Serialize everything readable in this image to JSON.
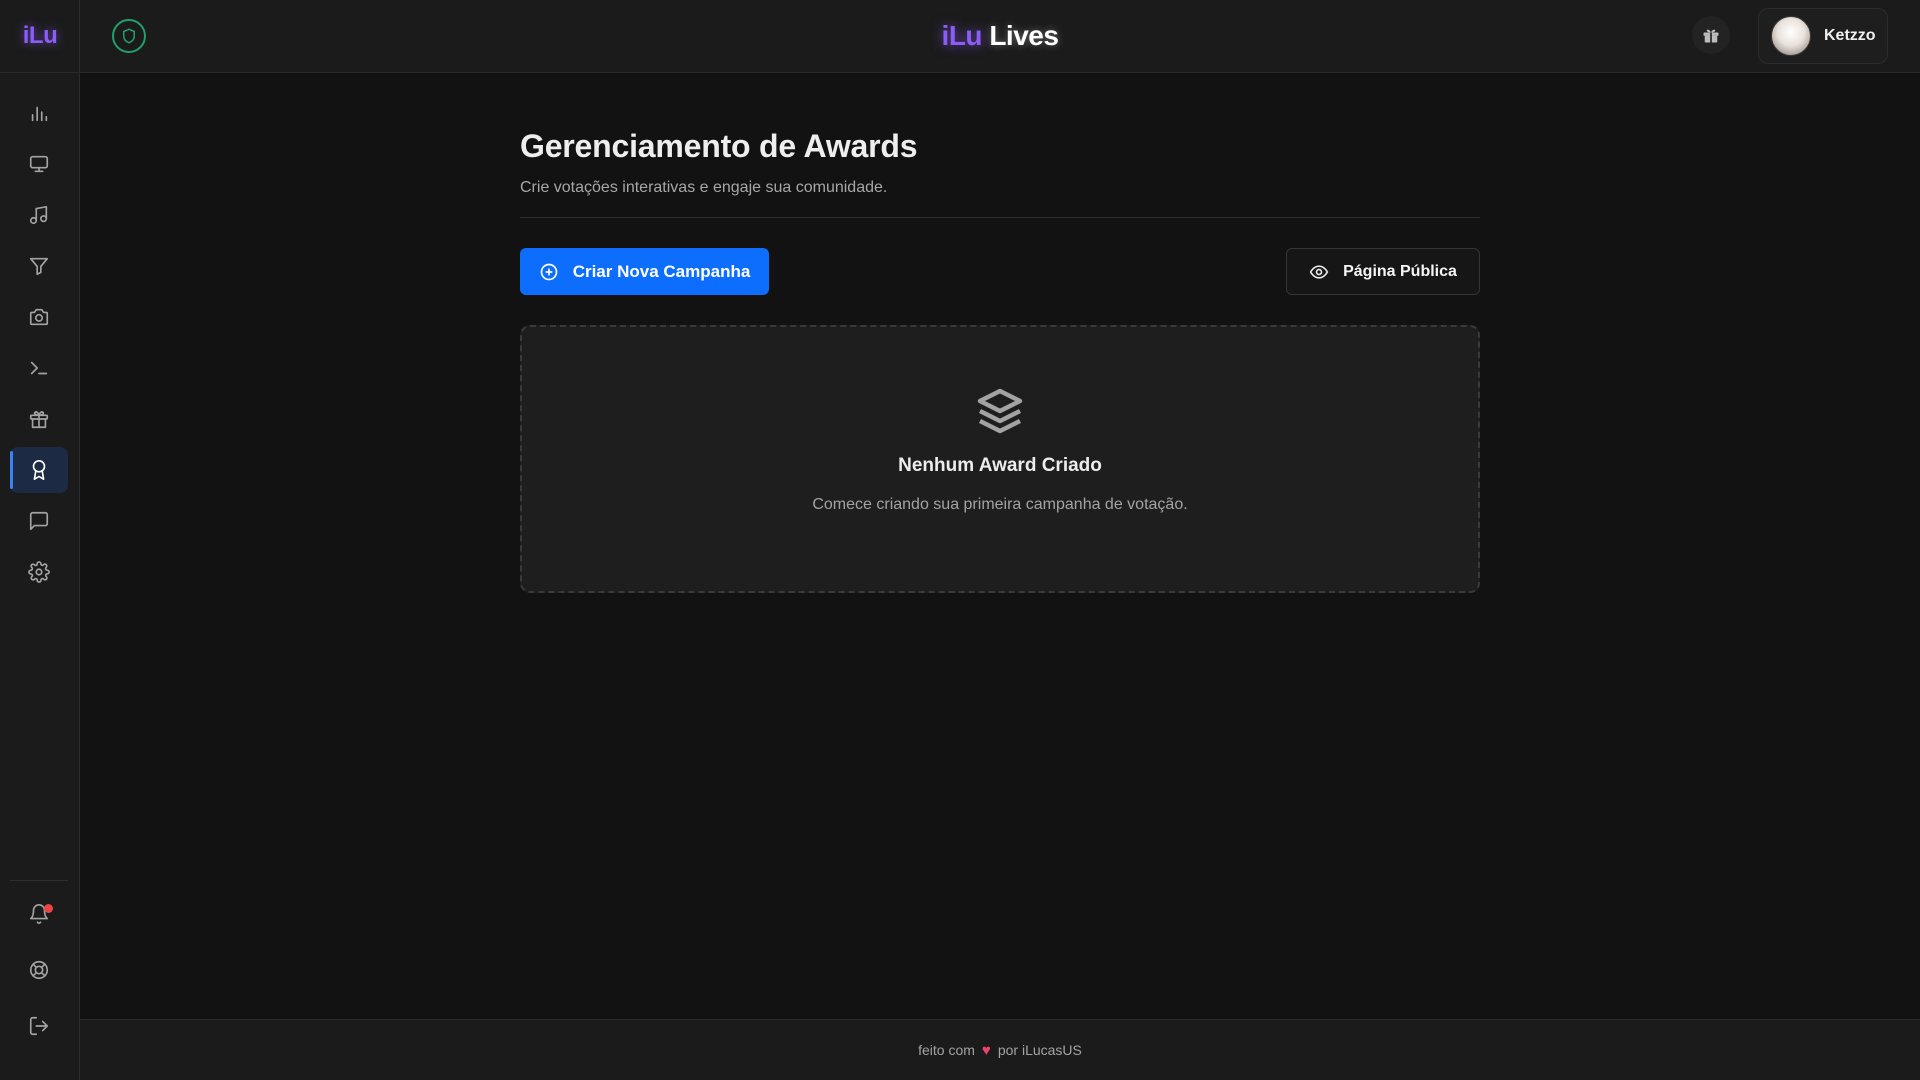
{
  "app": {
    "logo_short": "iLu",
    "brand_part1": "iLu",
    "brand_part2": "Lives"
  },
  "sidebar": {
    "items": [
      {
        "name": "stats",
        "icon": "bar-chart-icon"
      },
      {
        "name": "overlays",
        "icon": "monitor-icon"
      },
      {
        "name": "music",
        "icon": "music-note-icon"
      },
      {
        "name": "filters",
        "icon": "filter-icon"
      },
      {
        "name": "camera",
        "icon": "camera-icon"
      },
      {
        "name": "commands",
        "icon": "terminal-icon"
      },
      {
        "name": "gifts",
        "icon": "gift-icon"
      },
      {
        "name": "awards",
        "icon": "award-icon",
        "active": true
      },
      {
        "name": "chat",
        "icon": "chat-icon"
      },
      {
        "name": "settings",
        "icon": "gear-icon"
      }
    ],
    "bottom": [
      {
        "name": "notifications",
        "icon": "bell-icon",
        "has_unread": true
      },
      {
        "name": "support",
        "icon": "lifebuoy-icon"
      },
      {
        "name": "logout",
        "icon": "logout-icon"
      }
    ]
  },
  "header": {
    "user_name": "Ketzzo"
  },
  "main": {
    "title": "Gerenciamento de Awards",
    "subtitle": "Crie votações interativas e engaje sua comunidade.",
    "create_button": "Criar Nova Campanha",
    "public_button": "Página Pública",
    "empty_title": "Nenhum Award Criado",
    "empty_desc": "Comece criando sua primeira campanha de votação."
  },
  "footer": {
    "prefix": "feito com",
    "suffix": "por iLucasUS"
  },
  "colors": {
    "accent": "#0d6efd",
    "brand_purple": "#8b5cf6",
    "shield_green": "#22a06b",
    "heart": "#ef4468"
  }
}
